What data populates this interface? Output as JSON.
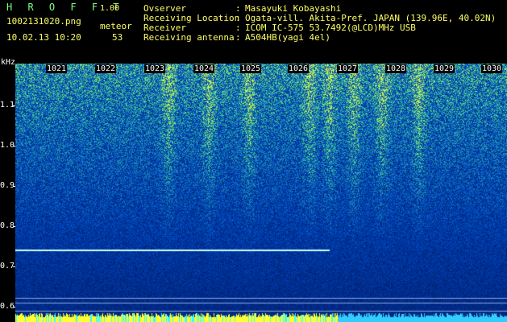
{
  "app": {
    "name": "H R O F F T",
    "version": "1.00"
  },
  "file": {
    "name": "1002131020.png",
    "datetime": "10.02.13 10:20"
  },
  "meteor": {
    "label": "meteor",
    "count": "53"
  },
  "info": [
    {
      "key": "Ovserver",
      "sep": ":",
      "value": "Masayuki Kobayashi"
    },
    {
      "key": "Receiving Location",
      "sep": ":",
      "value": "Ogata-vill. Akita-Pref. JAPAN (139.96E, 40.02N)"
    },
    {
      "key": "Receiver",
      "sep": ":",
      "value": "ICOM IC-575 53.7492(@LCD)MHz USB"
    },
    {
      "key": "Receiving antenna",
      "sep": ":",
      "value": "A504HB(yagi 4el)"
    }
  ],
  "axis": {
    "unit": "kHz",
    "yticks": [
      "1.1",
      "1.0",
      "0.9",
      "0.8",
      "0.7",
      "0.6"
    ],
    "minutes": [
      "1021",
      "1022",
      "1023",
      "1024",
      "1025",
      "1026",
      "1027",
      "1028",
      "1029",
      "1030"
    ]
  },
  "colors": {
    "background": "#000000",
    "spectrum_low": "#0a1f8c",
    "spectrum_high": "#7cff7c",
    "carrier": "#ccffff",
    "label_yellow": "#ffff66",
    "title_green": "#7cff7c"
  }
}
